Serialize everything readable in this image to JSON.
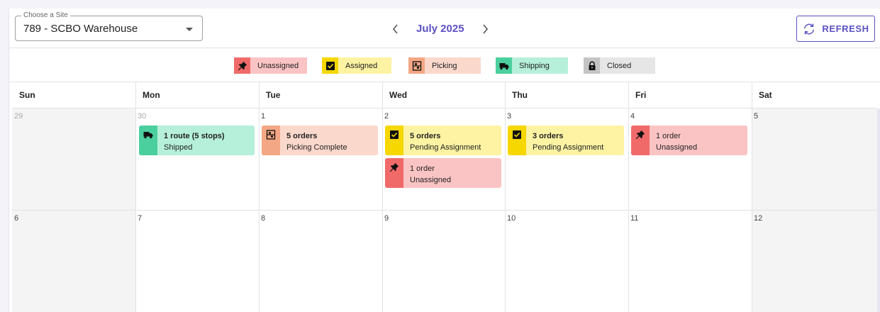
{
  "header": {
    "site_label": "Choose a Site",
    "site_value": "789 - SCBO Warehouse",
    "month": "July 2025",
    "refresh_label": "REFRESH"
  },
  "legend": [
    {
      "label": "Unassigned",
      "icon": "pin-icon",
      "icon_color": "#f06a6a",
      "bg_color": "#fbc4c4"
    },
    {
      "label": "Assigned",
      "icon": "check-box-icon",
      "icon_color": "#f6d700",
      "bg_color": "#fdf3a3"
    },
    {
      "label": "Picking",
      "icon": "picking-icon",
      "icon_color": "#f4a784",
      "bg_color": "#fbd8cc"
    },
    {
      "label": "Shipping",
      "icon": "truck-icon",
      "icon_color": "#4ccf9e",
      "bg_color": "#b6f0da"
    },
    {
      "label": "Closed",
      "icon": "lock-icon",
      "icon_color": "#c4c4c4",
      "bg_color": "#e6e6e6"
    }
  ],
  "weekdays": [
    "Sun",
    "Mon",
    "Tue",
    "Wed",
    "Thu",
    "Fri",
    "Sat"
  ],
  "weeks": [
    [
      "29",
      "30",
      "1",
      "2",
      "3",
      "4",
      "5"
    ],
    [
      "6",
      "7",
      "8",
      "9",
      "10",
      "11",
      "12"
    ]
  ],
  "events": {
    "mon_shipping": {
      "title": "1 route (5 stops)",
      "subtitle": "Shipped"
    },
    "tue_picking": {
      "title": "5 orders",
      "subtitle": "Picking Complete"
    },
    "wed_assigned": {
      "title": "5 orders",
      "subtitle": "Pending Assignment"
    },
    "wed_unassigned": {
      "title": "1 order",
      "subtitle": "Unassigned"
    },
    "thu_assigned": {
      "title": "3 orders",
      "subtitle": "Pending Assignment"
    },
    "fri_unassigned": {
      "title": "1 order",
      "subtitle": "Unassigned"
    }
  },
  "colors": {
    "accent": "#5a52c2",
    "unassigned": "#f06a6a",
    "unassigned_bg": "#fbc4c4",
    "assigned": "#f6d700",
    "assigned_bg": "#fdf3a3",
    "picking": "#f4a784",
    "picking_bg": "#fbd8cc",
    "shipping": "#4ccf9e",
    "shipping_bg": "#b6f0da"
  }
}
